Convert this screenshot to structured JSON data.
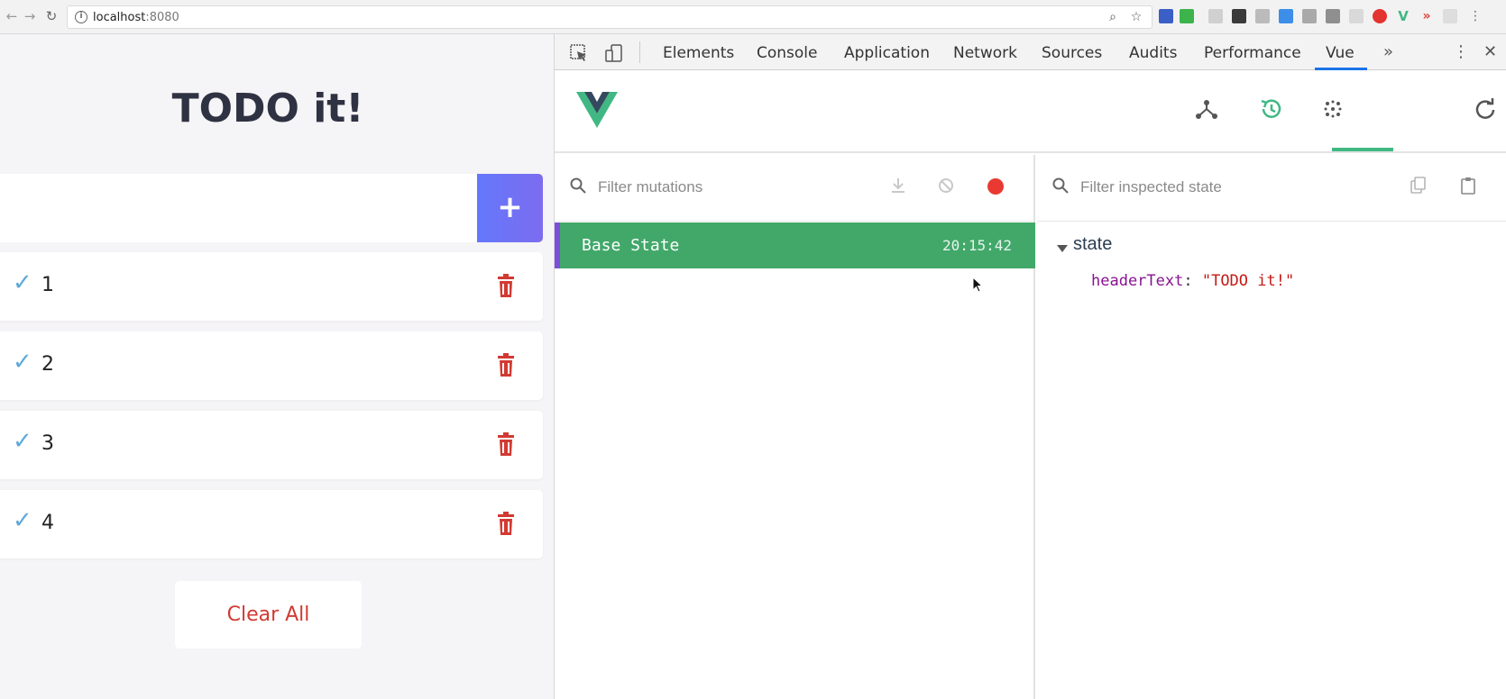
{
  "browser": {
    "url_host": "localhost",
    "url_port": ":8080"
  },
  "app": {
    "title": "TODO it!",
    "add_button_label": "+",
    "todos": [
      {
        "text": "1"
      },
      {
        "text": "2"
      },
      {
        "text": "3"
      },
      {
        "text": "4"
      }
    ],
    "clear_all_label": "Clear All"
  },
  "devtools": {
    "tabs": [
      {
        "label": "Elements"
      },
      {
        "label": "Console"
      },
      {
        "label": "Application"
      },
      {
        "label": "Network"
      },
      {
        "label": "Sources"
      },
      {
        "label": "Audits"
      },
      {
        "label": "Performance"
      },
      {
        "label": "Vue"
      }
    ],
    "active_tab": "Vue",
    "overflow_label": "»"
  },
  "vue_devtools": {
    "active_view": "vuex",
    "mutations_filter_placeholder": "Filter mutations",
    "state_filter_placeholder": "Filter inspected state",
    "mutations": [
      {
        "name": "Base State",
        "time": "20:15:42"
      }
    ],
    "state_root_label": "state",
    "state_entries": [
      {
        "key": "headerText",
        "value": "\"TODO it!\""
      }
    ]
  },
  "colors": {
    "accent_vue_green": "#41b883",
    "selected_row": "#41a86a",
    "add_button": "#6478fb",
    "trash_red": "#d13a33",
    "check_blue": "#5fa9d8",
    "record_red": "#e83a33"
  }
}
